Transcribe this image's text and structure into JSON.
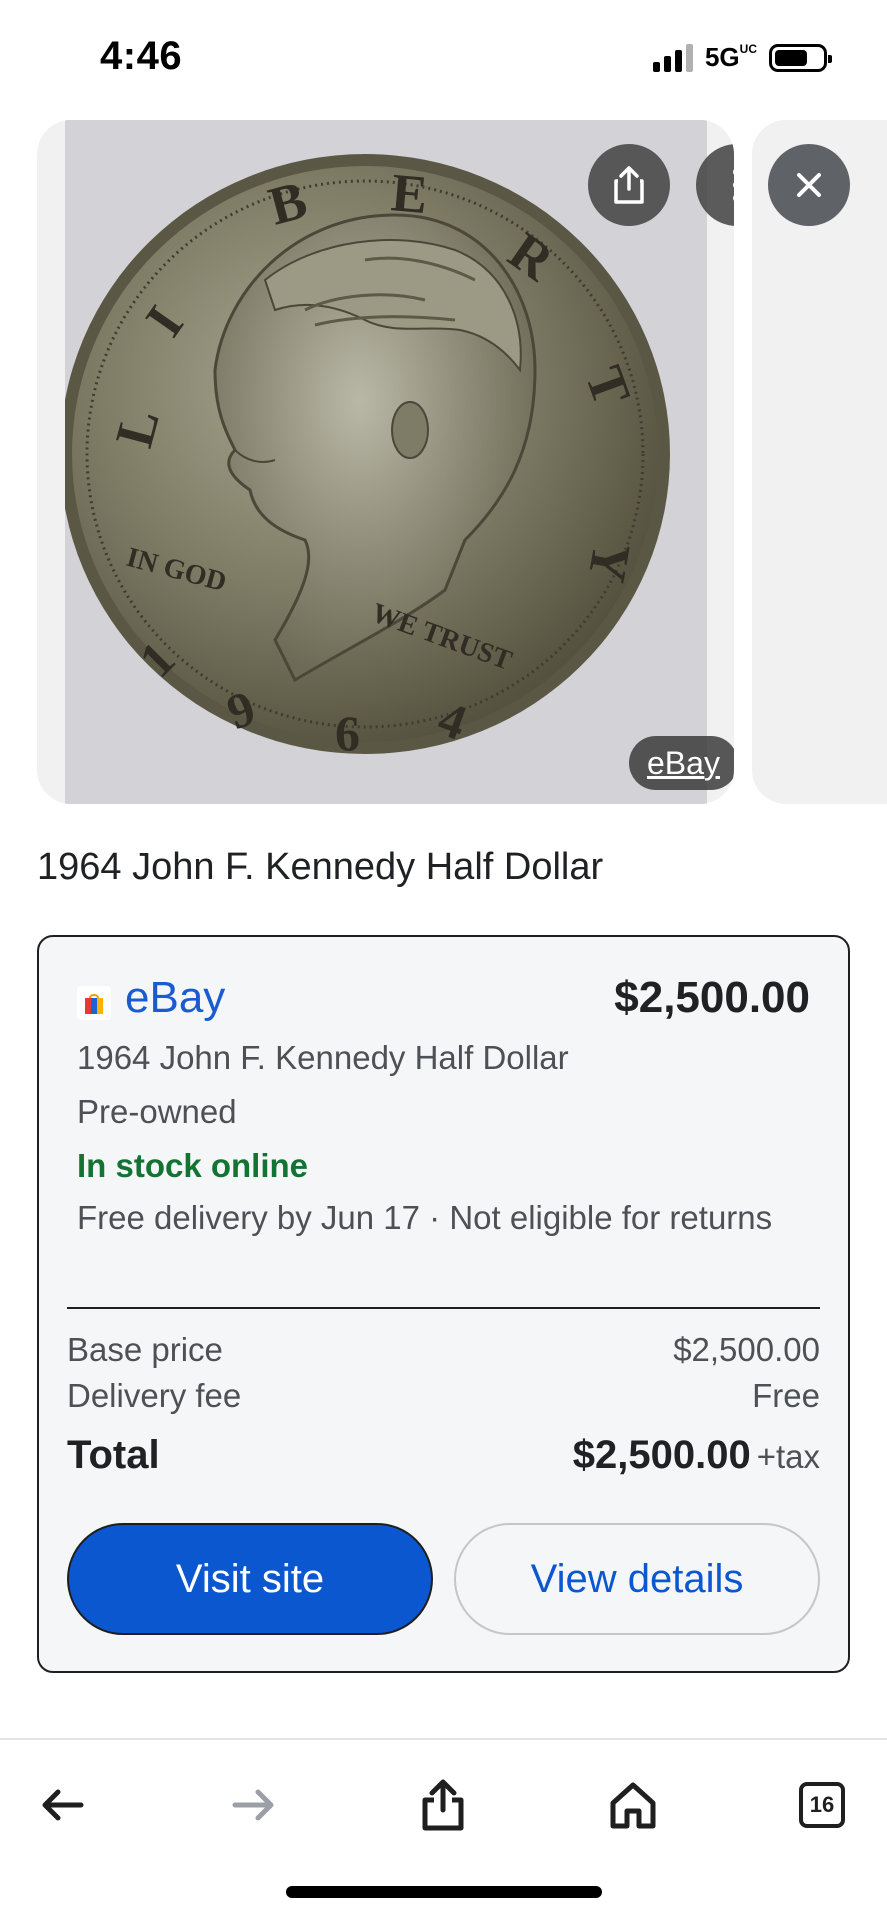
{
  "status_bar": {
    "time": "4:46",
    "network": "5G",
    "network_suffix": "UC"
  },
  "image_viewer": {
    "source_chip": "eBay",
    "coin_legend": {
      "liberty": "LIBERTY",
      "in_god": "IN GOD",
      "we_trust": "WE TRUST",
      "year": "1964"
    }
  },
  "product": {
    "title": "1964 John F. Kennedy Half Dollar"
  },
  "offer": {
    "seller": "eBay",
    "price": "$2,500.00",
    "item_title": "1964 John F. Kennedy Half Dollar",
    "condition": "Pre-owned",
    "stock": "In stock online",
    "delivery": "Free delivery by Jun 17 · Not eligible for returns",
    "base_price_label": "Base price",
    "base_price_value": "$2,500.00",
    "delivery_fee_label": "Delivery fee",
    "delivery_fee_value": "Free",
    "total_label": "Total",
    "total_value": "$2,500.00",
    "total_tax": "+tax",
    "visit_label": "Visit site",
    "details_label": "View details"
  },
  "toolbar": {
    "tab_count": "16"
  },
  "colors": {
    "link_blue": "#1a5ccf",
    "button_blue": "#0b57d0",
    "stock_green": "#137333"
  },
  "icons": [
    "share-icon",
    "more-vert-icon",
    "close-icon",
    "back-arrow-icon",
    "forward-arrow-icon",
    "home-icon",
    "tabs-icon",
    "shopping-bag-icon"
  ]
}
